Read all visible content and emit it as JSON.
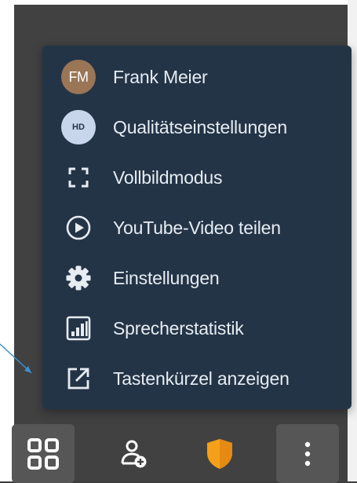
{
  "menu": {
    "items": [
      {
        "label": "Frank Meier",
        "icon": "avatar",
        "initials": "FM"
      },
      {
        "label": "Qualitätseinstellungen",
        "icon": "hd-quality-icon",
        "badge": "HD"
      },
      {
        "label": "Vollbildmodus",
        "icon": "fullscreen-icon"
      },
      {
        "label": "YouTube-Video teilen",
        "icon": "play-circle-icon"
      },
      {
        "label": "Einstellungen",
        "icon": "gear-icon"
      },
      {
        "label": "Sprecherstatistik",
        "icon": "bar-chart-icon"
      },
      {
        "label": "Tastenkürzel anzeigen",
        "icon": "open-external-icon"
      }
    ]
  },
  "toolbar": {
    "buttons": [
      {
        "name": "tile-view",
        "icon": "grid-icon"
      },
      {
        "name": "invite",
        "icon": "add-participant-icon"
      },
      {
        "name": "security",
        "icon": "shield-icon"
      },
      {
        "name": "more",
        "icon": "more-vertical-icon"
      }
    ]
  },
  "colors": {
    "menu_background": "#243447",
    "menu_text": "#e6ecf2",
    "avatar_background": "#9a7556",
    "hd_badge_background": "#c7d6ea",
    "shield_orange": "#f5a01a",
    "toolbar_active": "#565656",
    "pointer_line": "#3d8fd1"
  }
}
